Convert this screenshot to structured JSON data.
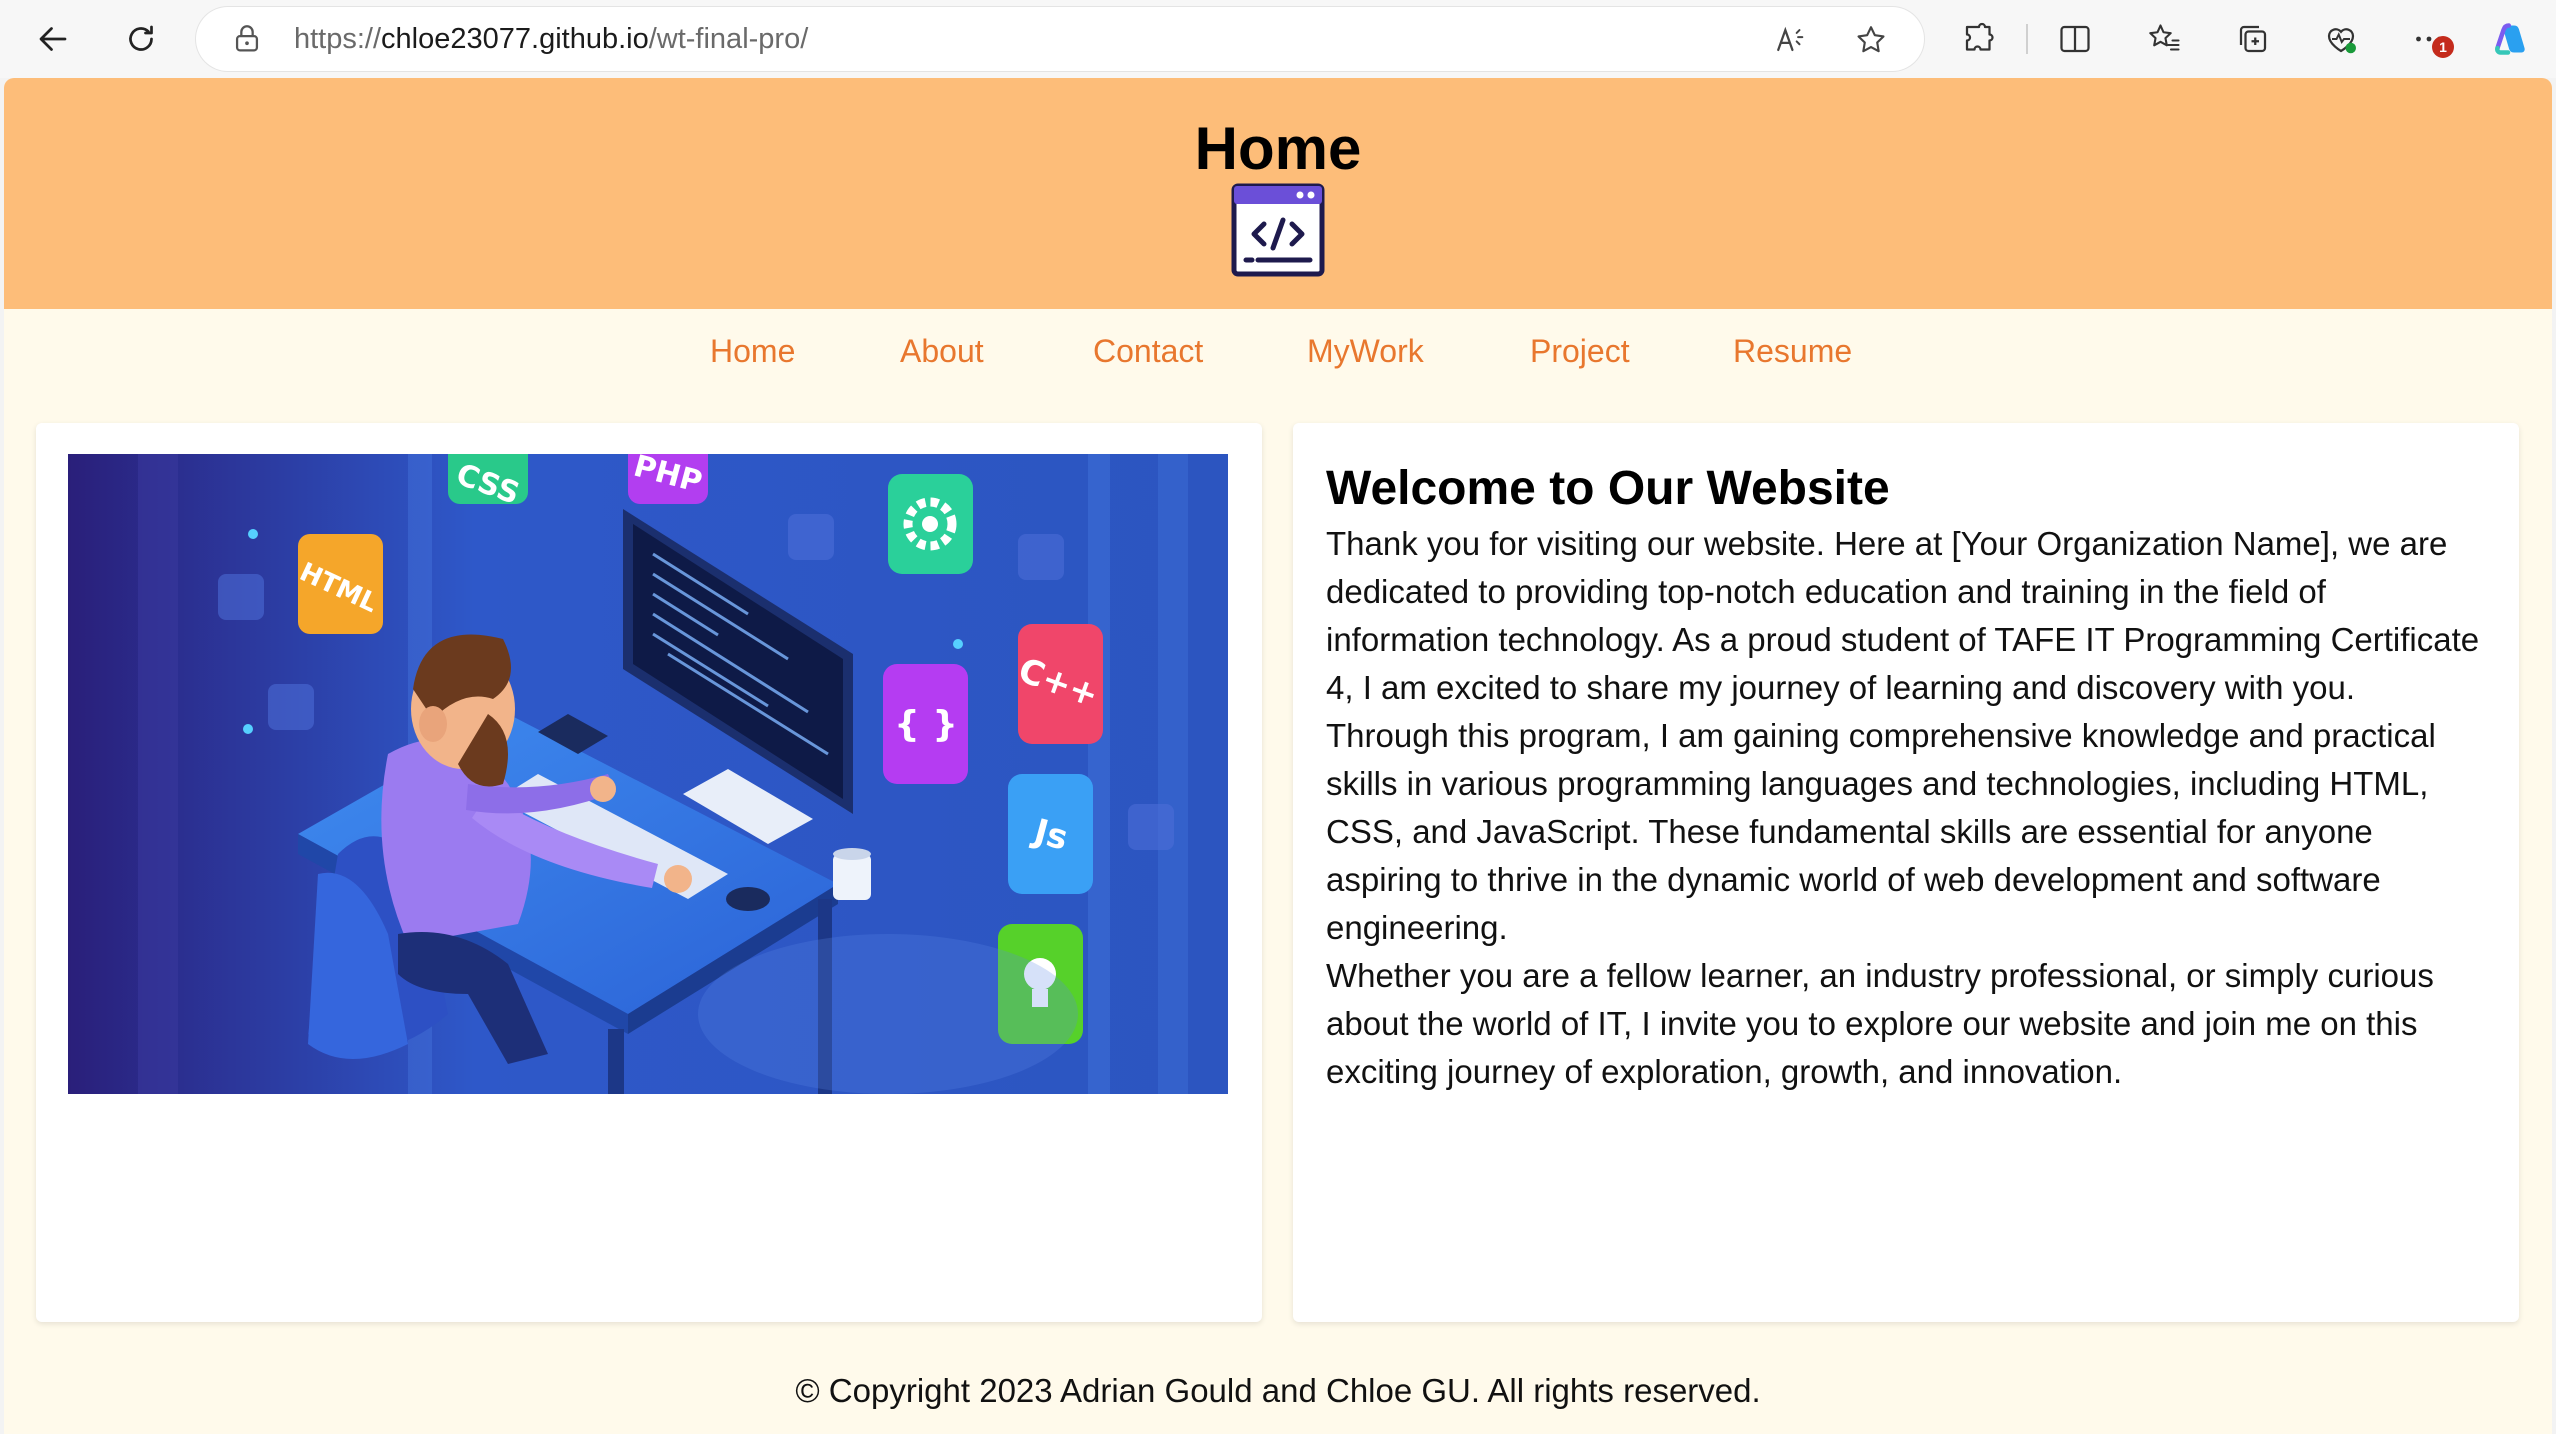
{
  "browser": {
    "url_prefix": "https://",
    "url_host": "chloe23077.github.io",
    "url_path": "/wt-final-pro/",
    "notification_count": "1",
    "icons": [
      "back-arrow-icon",
      "refresh-icon",
      "lock-icon",
      "read-aloud-icon",
      "favorite-star-icon",
      "extensions-icon",
      "split-screen-icon",
      "favorites-icon",
      "collections-icon",
      "browser-essentials-icon",
      "more-menu-icon",
      "copilot-icon"
    ]
  },
  "header": {
    "title": "Home",
    "logo_icon": "code-window-icon"
  },
  "nav": {
    "items": [
      {
        "label": "Home"
      },
      {
        "label": "About"
      },
      {
        "label": "Contact"
      },
      {
        "label": "MyWork"
      },
      {
        "label": "Project"
      },
      {
        "label": "Resume"
      }
    ]
  },
  "hero": {
    "icon_labels": [
      "CSS",
      "PHP",
      "HTML",
      "C++",
      "{ }",
      "Js"
    ]
  },
  "welcome": {
    "title": "Welcome to Our Website",
    "paragraphs": [
      "Thank you for visiting our website. Here at [Your Organization Name], we are dedicated to providing top-notch education and training in the field of information technology. As a proud student of TAFE IT Programming Certificate 4, I am excited to share my journey of learning and discovery with you.",
      "Through this program, I am gaining comprehensive knowledge and practical skills in various programming languages and technologies, including HTML, CSS, and JavaScript. These fundamental skills are essential for anyone aspiring to thrive in the dynamic world of web development and software engineering.",
      "Whether you are a fellow learner, an industry professional, or simply curious about the world of IT, I invite you to explore our website and join me on this exciting journey of exploration, growth, and innovation."
    ]
  },
  "footer": {
    "text": "© Copyright 2023 Adrian Gould and Chloe GU. All rights reserved."
  },
  "colors": {
    "header_bg": "#fdbd79",
    "page_bg": "#fffaeb",
    "nav_link": "#e8772e"
  }
}
